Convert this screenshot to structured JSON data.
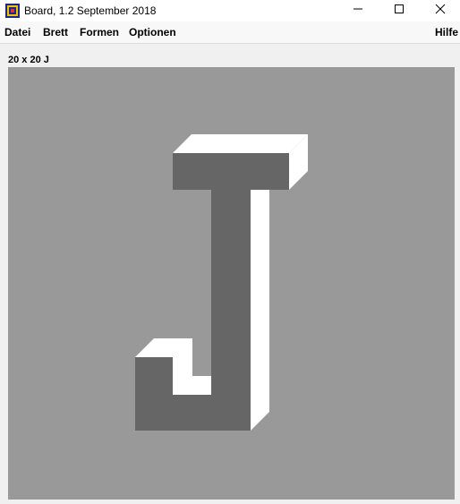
{
  "window": {
    "title": "Board, 1.2 September 2018",
    "app_icon": "board-app-icon",
    "controls": [
      "minimize-icon",
      "maximize-icon",
      "close-icon"
    ]
  },
  "menu": {
    "items": [
      "Datei",
      "Brett",
      "Formen",
      "Optionen"
    ],
    "help": "Hilfe"
  },
  "board": {
    "label": "20 x 20 J",
    "letter": "J",
    "colors": {
      "background": "#999999",
      "front_face": "#666666",
      "top_face": "#ffffff",
      "side_face": "#ffffff"
    }
  }
}
